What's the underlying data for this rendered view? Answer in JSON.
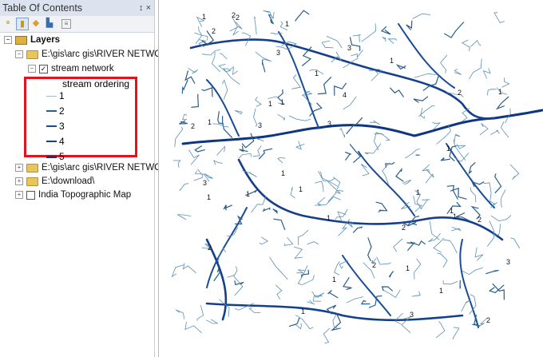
{
  "toc": {
    "title": "Table Of Contents",
    "pin": "↕",
    "close": "×",
    "tools": [
      "list-by-drawing-order",
      "list-by-source",
      "list-by-visibility",
      "list-by-selection",
      "options"
    ],
    "layers_label": "Layers",
    "items": [
      {
        "label": "E:\\gis\\arc gis\\RIVER NETWO",
        "expand": "−"
      },
      {
        "label": "stream network",
        "expand": "−",
        "checked": "✓"
      },
      {
        "label": "E:\\gis\\arc gis\\RIVER NETWO",
        "expand": "+"
      },
      {
        "label": "E:\\download\\",
        "expand": "+"
      },
      {
        "label": "India Topographic Map",
        "expand": "+"
      }
    ],
    "legend": {
      "title": "stream ordering",
      "classes": [
        {
          "label": "1",
          "color": "#a9b8c4"
        },
        {
          "label": "2",
          "color": "#2a5e8c"
        },
        {
          "label": "3",
          "color": "#1a4c96"
        },
        {
          "label": "4",
          "color": "#153f8a"
        },
        {
          "label": "5",
          "color": "#0e3580"
        }
      ]
    }
  },
  "map": {
    "labels": [
      "2",
      "1",
      "2",
      "1",
      "1",
      "1",
      "1",
      "2",
      "3",
      "1",
      "4",
      "1",
      "2",
      "3",
      "1",
      "1",
      "2",
      "3",
      "3",
      "1",
      "1",
      "2",
      "1",
      "2",
      "3",
      "1",
      "1",
      "1",
      "3",
      "2",
      "1",
      "1",
      "1",
      "2",
      "1",
      "1",
      "3",
      "2",
      "1"
    ]
  }
}
